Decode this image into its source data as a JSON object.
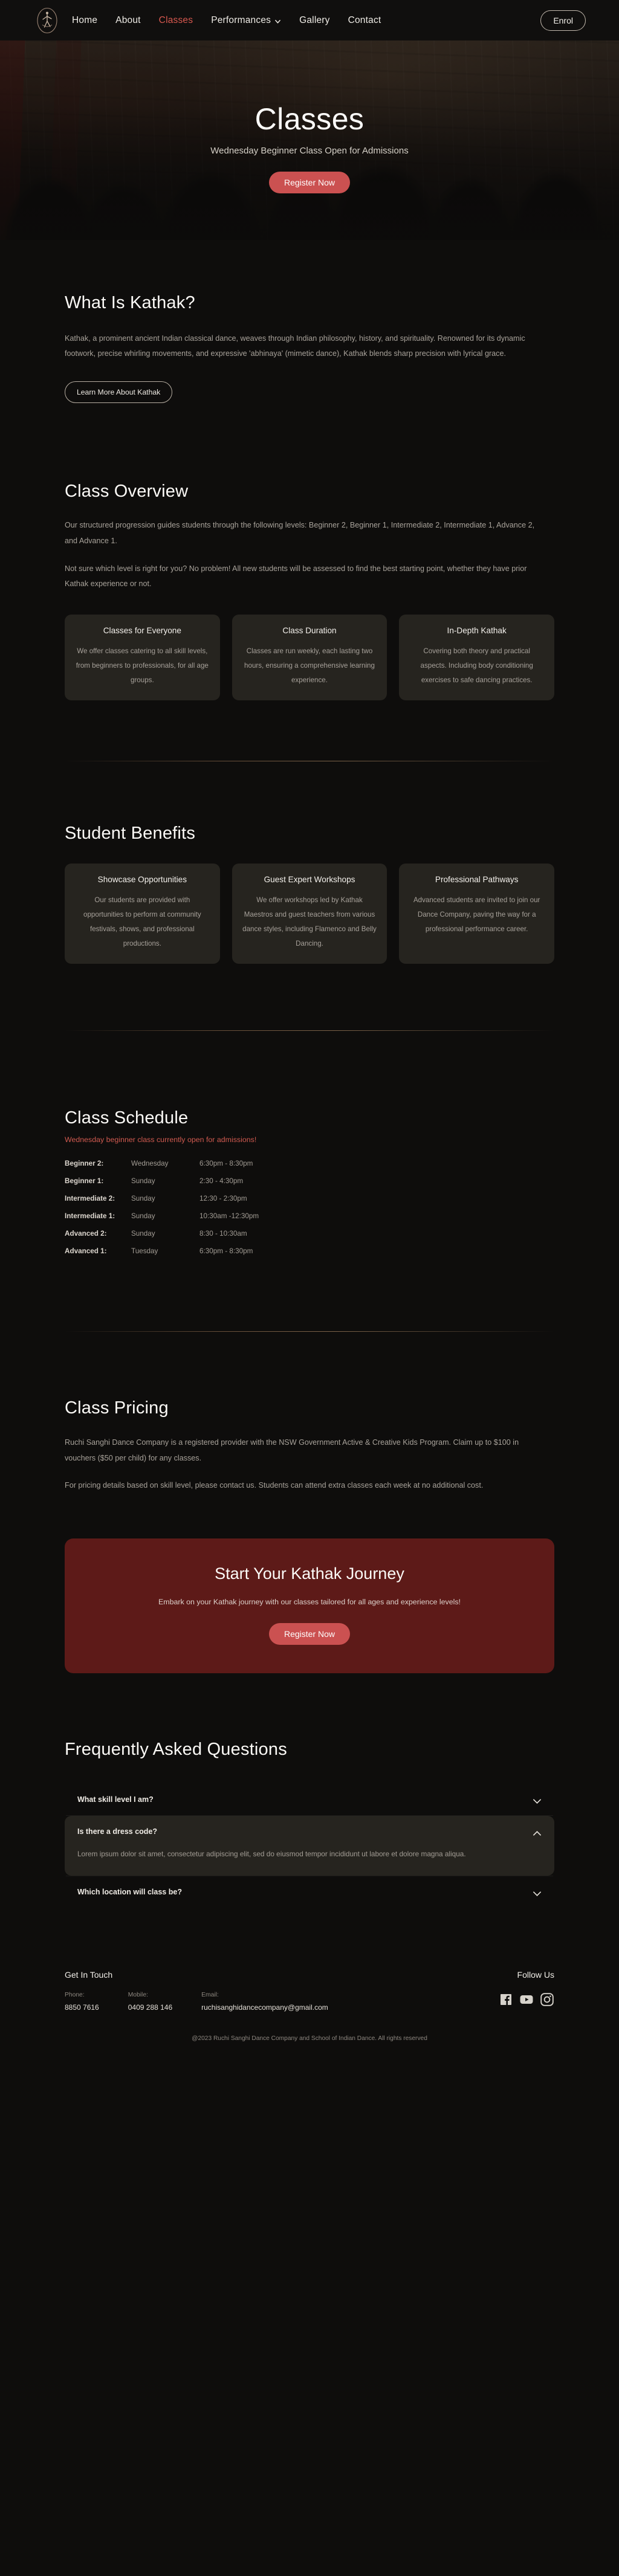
{
  "nav": {
    "logo_alt": "Ruchi Sanghi Dance Company logo",
    "links": [
      {
        "label": "Home",
        "active": false
      },
      {
        "label": "About",
        "active": false
      },
      {
        "label": "Classes",
        "active": true
      },
      {
        "label": "Performances",
        "active": false,
        "dropdown": true
      },
      {
        "label": "Gallery",
        "active": false
      },
      {
        "label": "Contact",
        "active": false
      }
    ],
    "enrol_label": "Enrol",
    "accent_color": "#d8584f"
  },
  "hero": {
    "title": "Classes",
    "subtitle": "Wednesday Beginner Class Open for Admissions",
    "cta_label": "Register Now",
    "cta_color": "#cb5151"
  },
  "kathak": {
    "heading": "What Is Kathak?",
    "body": "Kathak, a prominent ancient Indian classical dance, weaves through Indian philosophy, history, and spirituality. Renowned for its dynamic footwork, precise whirling movements, and expressive 'abhinaya' (mimetic dance), Kathak blends sharp precision with lyrical grace.",
    "button_label": "Learn More About Kathak"
  },
  "overview": {
    "heading": "Class Overview",
    "paragraph_1": "Our structured progression guides students through the following levels: Beginner 2, Beginner 1, Intermediate 2, Intermediate 1, Advance 2, and Advance 1.",
    "paragraph_2": "Not sure which level is right for you? No problem! All new students will be assessed to find the best starting point, whether they have prior Kathak experience or not.",
    "cards": [
      {
        "title": "Classes for Everyone",
        "text": "We offer classes catering to all skill levels, from beginners to professionals, for all age groups."
      },
      {
        "title": "Class Duration",
        "text": "Classes are run weekly, each lasting two hours, ensuring a comprehensive learning experience."
      },
      {
        "title": "In-Depth Kathak",
        "text": "Covering both theory and practical aspects. Including body conditioning exercises to safe dancing practices."
      }
    ]
  },
  "benefits": {
    "heading": "Student Benefits",
    "cards": [
      {
        "title": "Showcase Opportunities",
        "text": "Our students are provided with opportunities to perform at community festivals, shows, and professional productions."
      },
      {
        "title": "Guest Expert Workshops",
        "text": "We offer workshops led by Kathak Maestros and guest teachers from various dance styles, including Flamenco and Belly Dancing."
      },
      {
        "title": "Professional Pathways",
        "text": "Advanced students are invited to join our Dance Company, paving the way for a professional performance career."
      }
    ]
  },
  "schedule": {
    "heading": "Class Schedule",
    "note": "Wednesday beginner class currently open for admissions!",
    "note_color": "#d05a50",
    "rows": [
      {
        "level": "Beginner 2:",
        "day": "Wednesday",
        "time": "6:30pm - 8:30pm"
      },
      {
        "level": "Beginner 1:",
        "day": "Sunday",
        "time": "2:30 - 4:30pm"
      },
      {
        "level": "Intermediate 2:",
        "day": "Sunday",
        "time": "12:30 - 2:30pm"
      },
      {
        "level": "Intermediate 1:",
        "day": "Sunday",
        "time": "10:30am -12:30pm"
      },
      {
        "level": "Advanced 2:",
        "day": "Sunday",
        "time": "8:30 - 10:30am"
      },
      {
        "level": "Advanced 1:",
        "day": "Tuesday",
        "time": "6:30pm - 8:30pm"
      }
    ]
  },
  "pricing": {
    "heading": "Class Pricing",
    "paragraph_1": "Ruchi Sanghi Dance Company is a registered provider with the NSW Government Active & Creative Kids Program. Claim up to $100 in vouchers ($50 per child) for any classes.",
    "paragraph_2": "For pricing details based on skill level, please contact us. Students can attend extra classes each week at no additional cost."
  },
  "cta_banner": {
    "title": "Start Your Kathak Journey",
    "subtitle": "Embark on your Kathak journey with our classes tailored for all ages and experience levels!",
    "button_label": "Register Now",
    "background_color": "#5d1a18"
  },
  "faq": {
    "heading": "Frequently Asked Questions",
    "items": [
      {
        "question": "What skill level I am?",
        "open": false,
        "answer": ""
      },
      {
        "question": "Is there a dress code?",
        "open": true,
        "answer": "Lorem ipsum dolor sit amet, consectetur adipiscing elit, sed do eiusmod tempor incididunt ut labore et dolore magna aliqua."
      },
      {
        "question": "Which location will class be?",
        "open": false,
        "answer": ""
      }
    ]
  },
  "footer": {
    "get_in_touch_heading": "Get In Touch",
    "follow_us_heading": "Follow Us",
    "contacts": [
      {
        "label": "Phone:",
        "value": "8850 7616"
      },
      {
        "label": "Mobile:",
        "value": "0409 288 146"
      },
      {
        "label": "Email:",
        "value": "ruchisanghidancecompany@gmail.com"
      }
    ],
    "socials": [
      {
        "name": "facebook-icon"
      },
      {
        "name": "youtube-icon"
      },
      {
        "name": "instagram-icon"
      }
    ],
    "copyright": "@2023 Ruchi Sanghi Dance Company and School of Indian Dance. All rights reserved"
  }
}
